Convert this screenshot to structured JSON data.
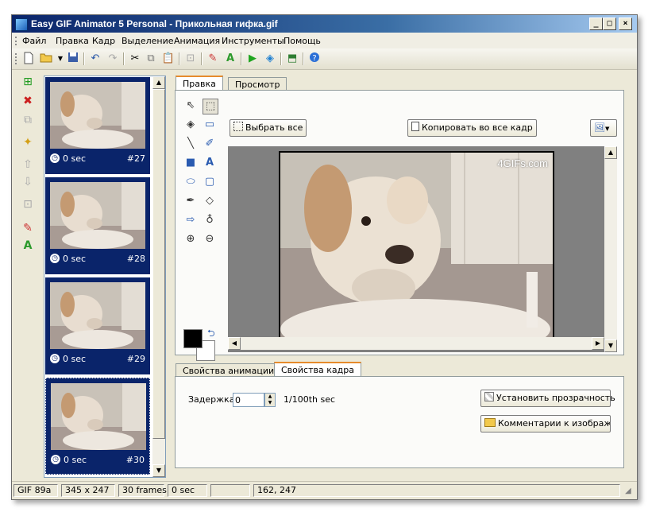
{
  "window": {
    "title": "Easy GIF Animator 5 Personal - Прикольная гифка.gif",
    "min_label": "_",
    "max_label": "□",
    "close_label": "×"
  },
  "menu": [
    "Файл",
    "Правка",
    "Кадр",
    "Выделение",
    "Анимация",
    "Инструменты",
    "Помощь"
  ],
  "frames": [
    {
      "delay": "0 sec",
      "number": "#27"
    },
    {
      "delay": "0 sec",
      "number": "#28"
    },
    {
      "delay": "0 sec",
      "number": "#29"
    },
    {
      "delay": "0 sec",
      "number": "#30"
    }
  ],
  "editor_tabs": {
    "edit": "Правка",
    "preview": "Просмотр"
  },
  "edit_pane": {
    "select_all": "Выбрать все",
    "copy_to_all": "Копировать во все кадр",
    "watermark": "4GIFs.com"
  },
  "props_tabs": {
    "animation": "Свойства анимации",
    "frame": "Свойства кадра"
  },
  "frame_props": {
    "delay_label": "Задержка:",
    "delay_value": "0",
    "delay_unit": "1/100th sec",
    "set_transparency": "Установить прозрачность",
    "image_comments": "Комментарии к изображен"
  },
  "status": {
    "format": "GIF 89a",
    "size": "345 x 247",
    "frames": "30 frames",
    "delay": "0 sec",
    "empty": "",
    "coords": "162,  247"
  },
  "colors": {
    "title_start": "#0a246a",
    "title_end": "#a6caf0",
    "frame_selected": "#0a246a",
    "tab_accent": "#e68b2c"
  }
}
